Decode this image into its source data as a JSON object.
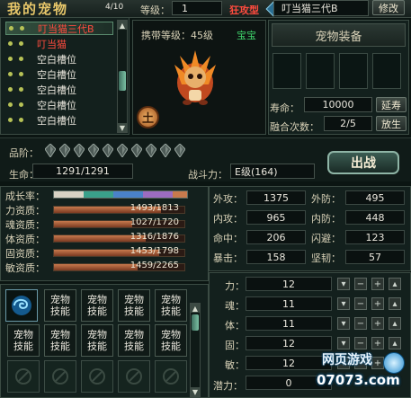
{
  "header": {
    "title": "我的宠物",
    "count": "4/10",
    "level_label": "等级：",
    "level_value": "1",
    "type_label": "狂攻型",
    "name_value": "叮当猫三代B",
    "edit_button": "修改"
  },
  "pet_list": [
    {
      "name": "叮当猫三代B",
      "color": "#ff4b3e",
      "selected": true
    },
    {
      "name": "叮当猫",
      "color": "#ff4b3e",
      "selected": false
    },
    {
      "name": "空白槽位",
      "color": "#e9e6dc",
      "selected": false
    },
    {
      "name": "空白槽位",
      "color": "#e9e6dc",
      "selected": false
    },
    {
      "name": "空白槽位",
      "color": "#e9e6dc",
      "selected": false
    },
    {
      "name": "空白槽位",
      "color": "#e9e6dc",
      "selected": false
    },
    {
      "name": "空白槽位",
      "color": "#e9e6dc",
      "selected": false
    }
  ],
  "portrait": {
    "carry_level": "携带等级：45级",
    "tag": "宝宝",
    "element": "土"
  },
  "equipment": {
    "title": "宠物装备",
    "lifespan_label": "寿命：",
    "lifespan_value": "10000",
    "extend_button": "延寿",
    "fusion_label": "融合次数：",
    "fusion_value": "2/5",
    "release_button": "放生"
  },
  "grade": {
    "label": "品阶：",
    "gems": 10
  },
  "life": {
    "label": "生命：",
    "value": "1291/1291"
  },
  "power": {
    "label": "战斗力：",
    "value": "E级(164)"
  },
  "battle_button": "出战",
  "growth_label": "成长率：",
  "aptitudes": [
    {
      "label": "力资质：",
      "value": "1493/1813",
      "ratio": 0.82
    },
    {
      "label": "魂资质：",
      "value": "1027/1720",
      "ratio": 0.6
    },
    {
      "label": "体资质：",
      "value": "1316/1876",
      "ratio": 0.7
    },
    {
      "label": "固资质：",
      "value": "1453/1798",
      "ratio": 0.81
    },
    {
      "label": "敏资质：",
      "value": "1459/2265",
      "ratio": 0.64
    }
  ],
  "combat": {
    "left": [
      {
        "label": "外攻：",
        "value": "1375"
      },
      {
        "label": "内攻：",
        "value": "965"
      },
      {
        "label": "命中：",
        "value": "206"
      },
      {
        "label": "暴击：",
        "value": "158"
      }
    ],
    "right": [
      {
        "label": "外防：",
        "value": "495"
      },
      {
        "label": "内防：",
        "value": "448"
      },
      {
        "label": "闪避：",
        "value": "123"
      },
      {
        "label": "坚韧：",
        "value": "57"
      }
    ]
  },
  "attributes": [
    {
      "label": "力：",
      "value": "12"
    },
    {
      "label": "魂：",
      "value": "11"
    },
    {
      "label": "体：",
      "value": "11"
    },
    {
      "label": "固：",
      "value": "12"
    },
    {
      "label": "敏：",
      "value": "12"
    }
  ],
  "potential": {
    "label": "潜力：",
    "value": "0"
  },
  "skills": {
    "label_line1": "宠物",
    "label_line2": "技能"
  },
  "watermark": {
    "text_top": "网页游戏",
    "text_bottom": "07073.com"
  },
  "colors": {
    "accent_gold": "#e8c76a",
    "accent_red": "#ff4b3e",
    "growth_segments": [
      "#d8d2c4",
      "#3aa08a",
      "#4a82c8",
      "#9c6cc0",
      "#c77a4d"
    ]
  }
}
